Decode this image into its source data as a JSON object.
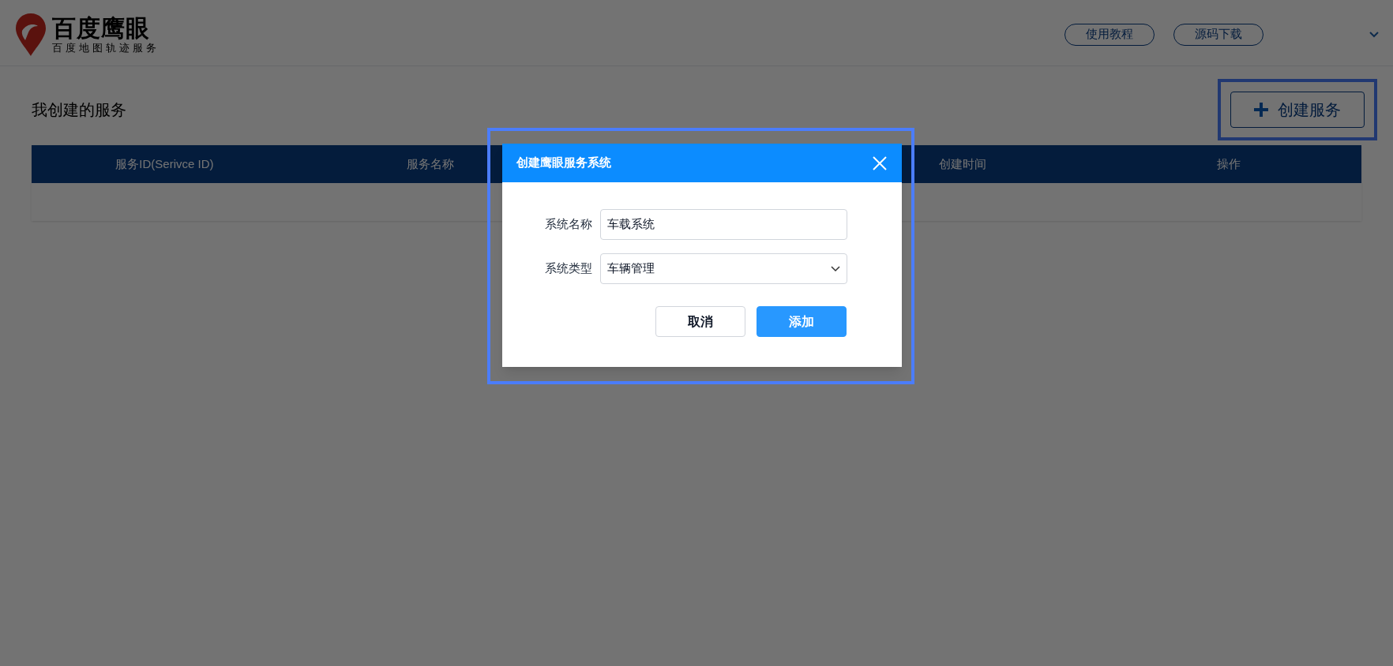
{
  "header": {
    "logo_title": "百度鹰眼",
    "logo_subtitle": "百度地图轨迹服务",
    "links": [
      "使用教程",
      "源码下载"
    ]
  },
  "page": {
    "title": "我创建的服务",
    "create_button": "创建服务"
  },
  "table": {
    "columns": [
      "服务ID(Serivce ID)",
      "服务名称",
      null,
      "创建时间",
      "操作"
    ]
  },
  "dialog": {
    "title": "创建鹰眼服务系统",
    "fields": [
      {
        "kind": "text",
        "label": "系统名称",
        "value": "车载系统"
      },
      {
        "kind": "select",
        "label": "系统类型",
        "value": "车辆管理"
      }
    ],
    "buttons": [
      {
        "kind": "secondary",
        "label": "取消"
      },
      {
        "kind": "primary",
        "label": "添加"
      }
    ]
  }
}
